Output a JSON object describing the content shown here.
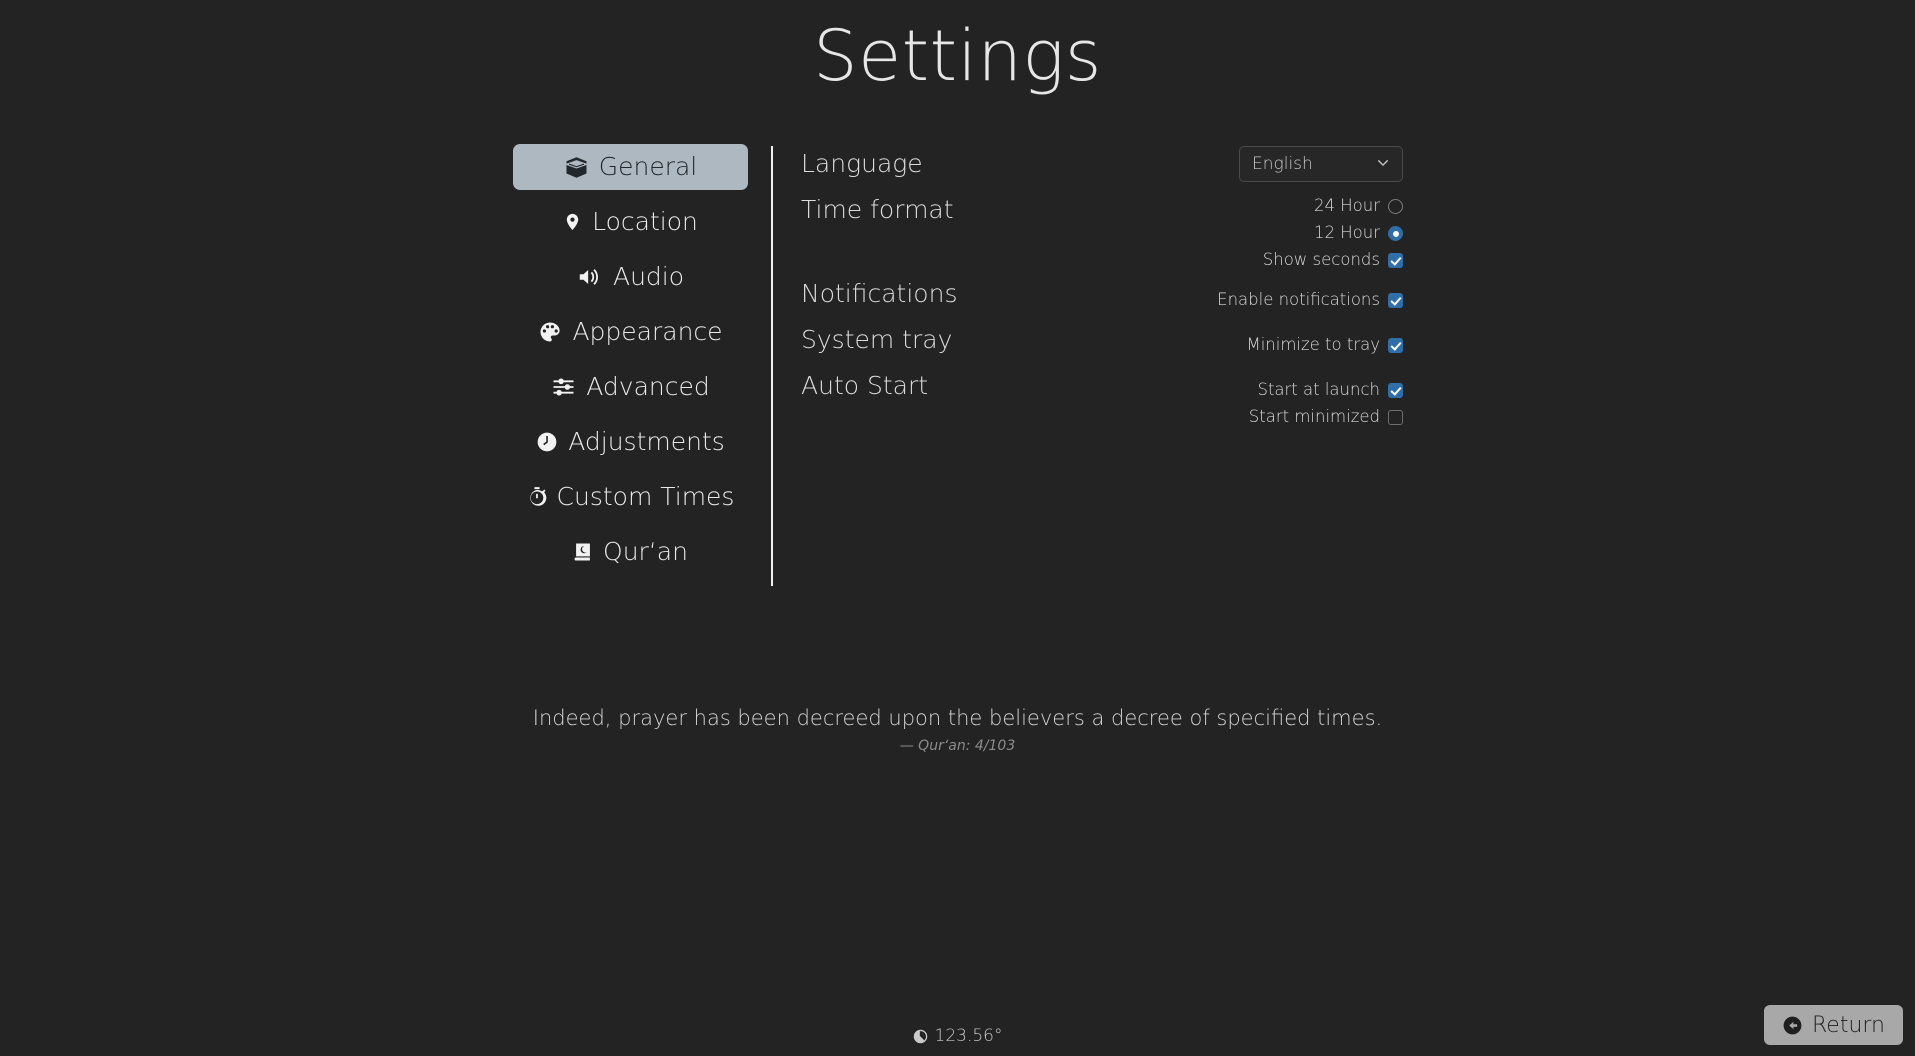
{
  "header": {
    "title": "Settings"
  },
  "sidebar": {
    "items": [
      {
        "label": "General",
        "icon": "kaaba-icon",
        "active": true
      },
      {
        "label": "Location",
        "icon": "map-pin-icon",
        "active": false
      },
      {
        "label": "Audio",
        "icon": "speaker-icon",
        "active": false
      },
      {
        "label": "Appearance",
        "icon": "palette-icon",
        "active": false
      },
      {
        "label": "Advanced",
        "icon": "sliders-icon",
        "active": false
      },
      {
        "label": "Adjustments",
        "icon": "clock-icon",
        "active": false
      },
      {
        "label": "Custom Times",
        "icon": "stopwatch-icon",
        "active": false
      },
      {
        "label": "Qur‘an",
        "icon": "quran-book-icon",
        "active": false
      }
    ]
  },
  "panel": {
    "language": {
      "label": "Language",
      "selected": "English",
      "options": [
        "English"
      ]
    },
    "time_format": {
      "label": "Time format",
      "options": [
        {
          "label": "24 Hour",
          "checked": false
        },
        {
          "label": "12 Hour",
          "checked": true
        }
      ],
      "show_seconds": {
        "label": "Show seconds",
        "checked": true
      }
    },
    "notifications": {
      "label": "Notifications",
      "enable": {
        "label": "Enable notifications",
        "checked": true
      }
    },
    "system_tray": {
      "label": "System tray",
      "minimize": {
        "label": "Minimize to tray",
        "checked": true
      }
    },
    "auto_start": {
      "label": "Auto Start",
      "start_at_launch": {
        "label": "Start at launch",
        "checked": true
      },
      "start_minimized": {
        "label": "Start minimized",
        "checked": false
      }
    }
  },
  "quote": {
    "text": "Indeed, prayer has been decreed upon the believers a decree of specified times.",
    "source": "—  Qur‘an: 4/103"
  },
  "status": {
    "qibla_direction": "123.56°",
    "icon": "compass-icon"
  },
  "footer": {
    "return_label": "Return",
    "return_icon": "arrow-circle-left-icon"
  },
  "colors": {
    "background": "#232323",
    "accent": "#2f6ea8",
    "active_nav": "#aeb8c0",
    "return_button": "#a8a8a8"
  }
}
